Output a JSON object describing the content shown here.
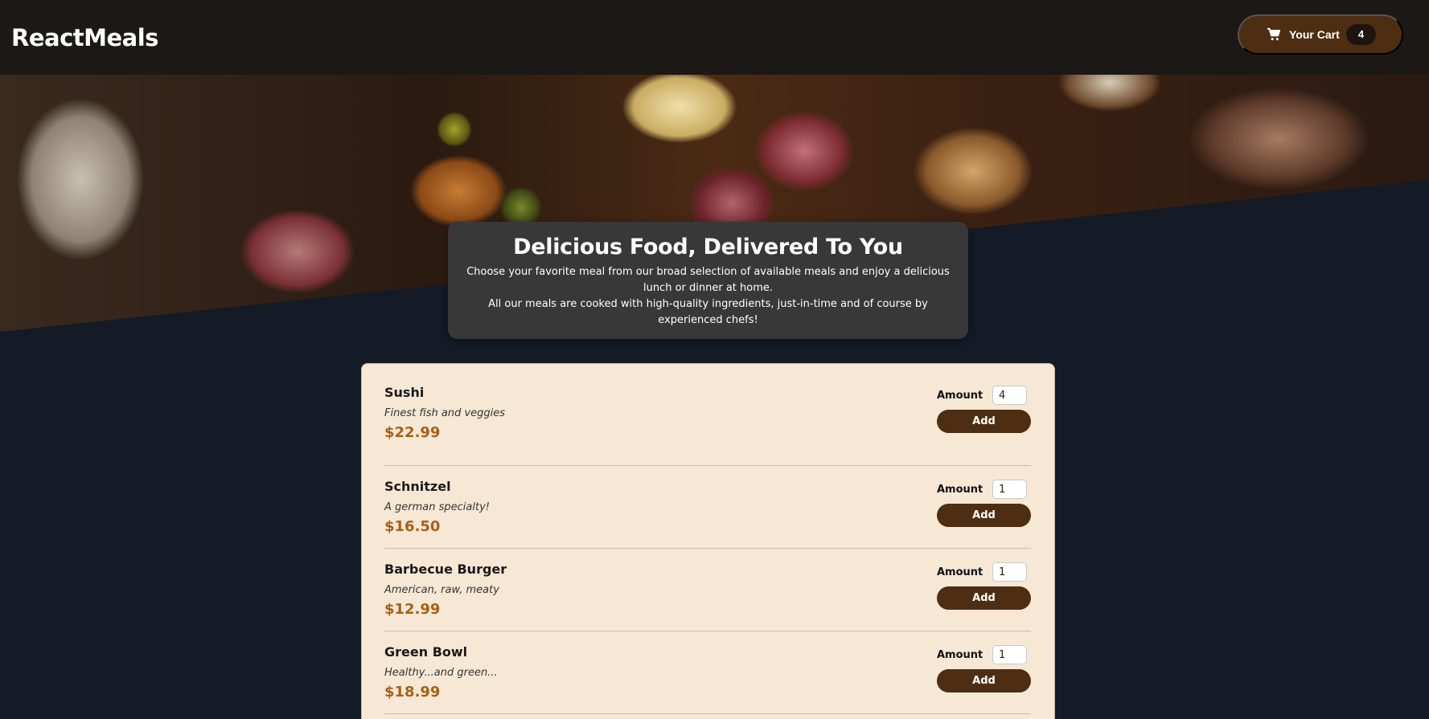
{
  "header": {
    "logo": "ReactMeals",
    "cart_label": "Your Cart",
    "cart_count": "4",
    "cart_icon": "cart-icon"
  },
  "summary": {
    "title": "Delicious Food, Delivered To You",
    "paragraph1": "Choose your favorite meal from our broad selection of available meals and enjoy a delicious lunch or dinner at home.",
    "paragraph2": "All our meals are cooked with high-quality ingredients, just-in-time and of course by experienced chefs!"
  },
  "meals": [
    {
      "name": "Sushi",
      "description": "Finest fish and veggies",
      "price": "$22.99",
      "amount_label": "Amount",
      "amount": "4",
      "add_label": "Add"
    },
    {
      "name": "Schnitzel",
      "description": "A german specialty!",
      "price": "$16.50",
      "amount_label": "Amount",
      "amount": "1",
      "add_label": "Add"
    },
    {
      "name": "Barbecue Burger",
      "description": "American, raw, meaty",
      "price": "$12.99",
      "amount_label": "Amount",
      "amount": "1",
      "add_label": "Add"
    },
    {
      "name": "Green Bowl",
      "description": "Healthy...and green...",
      "price": "$18.99",
      "amount_label": "Amount",
      "amount": "1",
      "add_label": "Add"
    }
  ],
  "colors": {
    "header_bg": "#1c1816",
    "page_bg": "#141a26",
    "accent_brown": "#4d2e12",
    "card_bg": "#f7e8d6",
    "price": "#a85f16"
  }
}
